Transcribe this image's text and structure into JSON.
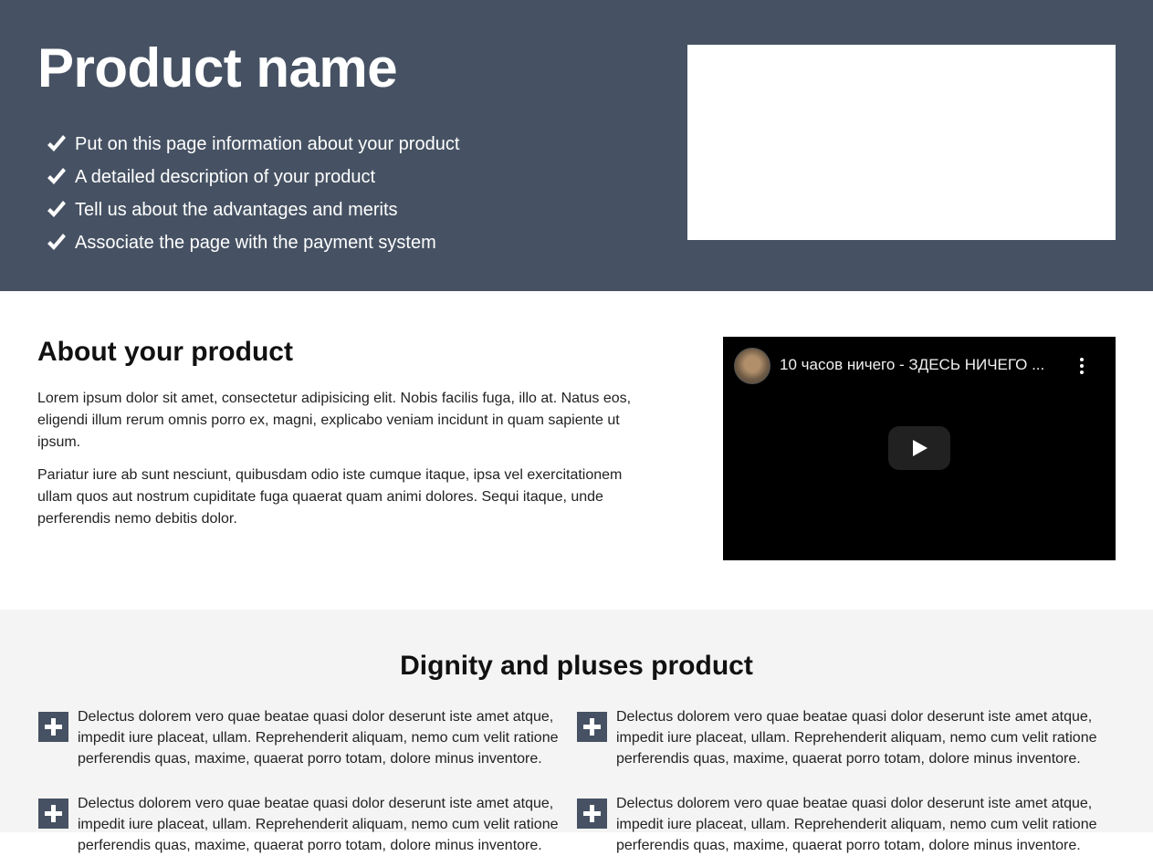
{
  "hero": {
    "title": "Product name",
    "features": [
      "Put on this page information about your product",
      "A detailed description of your product",
      "Tell us about the advantages and merits",
      "Associate the page with the payment system"
    ],
    "background_color": "#465263"
  },
  "about": {
    "title": "About your product",
    "paragraph1": "Lorem ipsum dolor sit amet, consectetur adipisicing elit. Nobis facilis fuga, illo at. Natus eos, eligendi illum rerum omnis porro ex, magni, explicabo veniam incidunt in quam sapiente ut ipsum.",
    "paragraph2": "Pariatur iure ab sunt nesciunt, quibusdam odio iste cumque itaque, ipsa vel exercitationem ullam quos aut nostrum cupiditate fuga quaerat quam animi dolores. Sequi itaque, unde perferendis nemo debitis dolor."
  },
  "video": {
    "title": "10 часов ничего - ЗДЕСЬ НИЧЕГО ...",
    "icons": [
      "channel-avatar",
      "more-options-icon",
      "play-icon"
    ]
  },
  "dignity": {
    "title": "Dignity and pluses product",
    "items": [
      "Delectus dolorem vero quae beatae quasi dolor deserunt iste amet atque, impedit iure placeat, ullam. Reprehenderit aliquam, nemo cum velit ratione perferendis quas, maxime, quaerat porro totam, dolore minus inventore.",
      "Delectus dolorem vero quae beatae quasi dolor deserunt iste amet atque, impedit iure placeat, ullam. Reprehenderit aliquam, nemo cum velit ratione perferendis quas, maxime, quaerat porro totam, dolore minus inventore.",
      "Delectus dolorem vero quae beatae quasi dolor deserunt iste amet atque, impedit iure placeat, ullam. Reprehenderit aliquam, nemo cum velit ratione perferendis quas, maxime, quaerat porro totam, dolore minus inventore.",
      "Delectus dolorem vero quae beatae quasi dolor deserunt iste amet atque, impedit iure placeat, ullam. Reprehenderit aliquam, nemo cum velit ratione perferendis quas, maxime, quaerat porro totam, dolore minus inventore."
    ]
  }
}
